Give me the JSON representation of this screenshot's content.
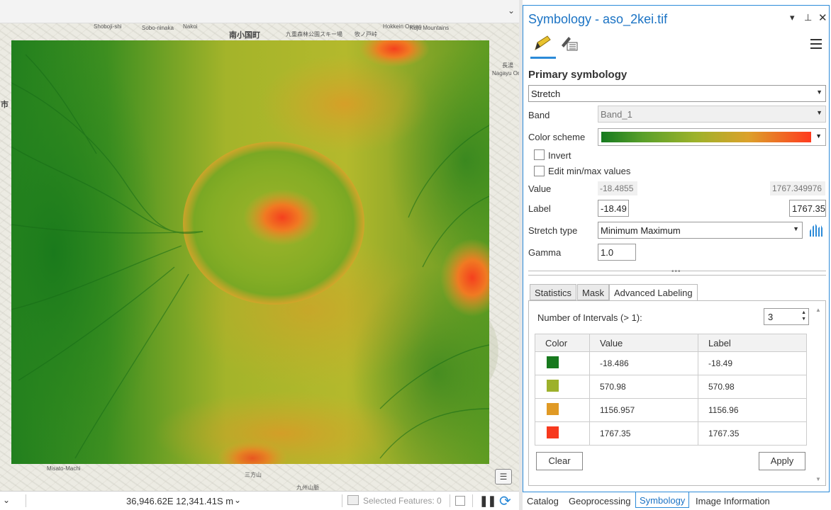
{
  "map": {
    "labels": [
      {
        "text": "Shoboji-shi"
      },
      {
        "text": "Sobo-ninaka"
      },
      {
        "text": "Nakoi"
      },
      {
        "text": "南小国町"
      },
      {
        "text": "九重森林公園スキー場"
      },
      {
        "text": "牧ノ戸峠"
      },
      {
        "text": "Hokkein Onsen"
      },
      {
        "text": "Kuju Mountains"
      },
      {
        "text": "長湯"
      },
      {
        "text": "Nagayu Onsen"
      },
      {
        "text": "市"
      },
      {
        "text": "Misato-Machi"
      },
      {
        "text": "三方山"
      },
      {
        "text": "九州山脈"
      }
    ],
    "status": {
      "coordinates": "36,946.62E 12,341.41S m",
      "selected_features": "Selected Features: 0"
    }
  },
  "pane": {
    "title": "Symbology - aso_2kei.tif",
    "title_buttons": {
      "menu": "▾",
      "pin": "⊥",
      "close": "✕"
    },
    "primary_heading": "Primary symbology",
    "renderer": "Stretch",
    "band_label": "Band",
    "band_value": "Band_1",
    "color_scheme_label": "Color scheme",
    "invert_label": "Invert",
    "edit_minmax_label": "Edit min/max values",
    "value_label": "Value",
    "value_min": "-18.4855",
    "value_max": "1767.349976",
    "label_label": "Label",
    "label_min": "-18.49",
    "label_max": "1767.35",
    "stretch_type_label": "Stretch type",
    "stretch_type": "Minimum Maximum",
    "gamma_label": "Gamma",
    "gamma_value": "1.0",
    "tabs": [
      "Statistics",
      "Mask",
      "Advanced Labeling"
    ],
    "active_tab": "Advanced Labeling",
    "intervals_label": "Number of Intervals (> 1):",
    "intervals_value": "3",
    "table": {
      "headers": [
        "Color",
        "Value",
        "Label"
      ],
      "rows": [
        {
          "color": "#17791d",
          "value": "-18.486",
          "label": "-18.49"
        },
        {
          "color": "#9db12b",
          "value": "570.98",
          "label": "570.98"
        },
        {
          "color": "#e09a25",
          "value": "1156.957",
          "label": "1156.96"
        },
        {
          "color": "#f7391e",
          "value": "1767.35",
          "label": "1767.35"
        }
      ]
    },
    "clear_button": "Clear",
    "apply_button": "Apply"
  },
  "bottom_tabs": [
    "Catalog",
    "Geoprocessing",
    "Symbology",
    "Image Information"
  ],
  "active_bottom_tab": "Symbology",
  "colors": {
    "accent": "#2b8ad8",
    "title": "#1b73c4",
    "ramp_low": "#157a1f",
    "ramp_high": "#ff3a1e"
  }
}
